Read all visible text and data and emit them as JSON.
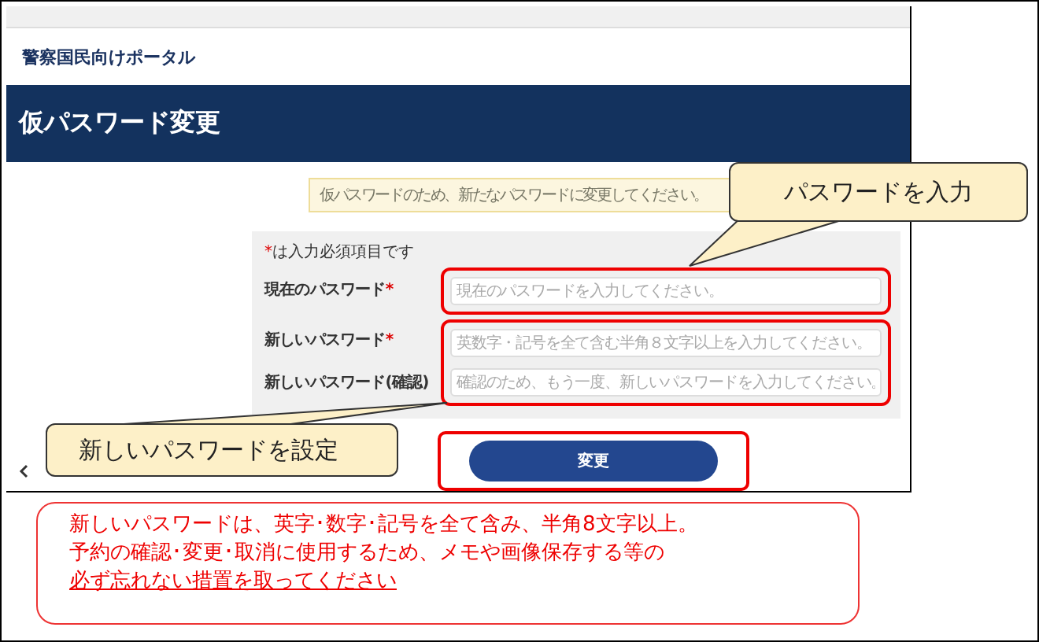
{
  "portal_name": "警察国民向けポータル",
  "banner_title": "仮パスワード変更",
  "notice": "仮パスワードのため、新たなパスワードに変更してください。",
  "form": {
    "required_note": {
      "mark": "*",
      "text": "は入力必須項目です"
    },
    "groups": [
      {
        "highlighted": true,
        "fields": [
          {
            "label": "現在のパスワード",
            "mark": "*",
            "placeholder": "現在のパスワードを入力してください。"
          }
        ]
      },
      {
        "highlighted": true,
        "fields": [
          {
            "label": "新しいパスワード",
            "mark": "*",
            "placeholder": "英数字・記号を全て含む半角８文字以上を入力してください。"
          },
          {
            "label": "新しいパスワード(確認)",
            "placeholder": "確認のため、もう一度、新しいパスワードを入力してください。"
          }
        ]
      }
    ]
  },
  "submit": {
    "label": "変更",
    "highlighted": true
  },
  "callouts": [
    {
      "text": "パスワードを入力"
    },
    {
      "text": "新しいパスワードを設定"
    }
  ],
  "note": {
    "lines": [
      "新しいパスワードは、英字･数字･記号を全て含み、半角8文字以上。",
      "予約の確認･変更･取消に使用するため、メモや画像保存する等の"
    ],
    "underlined_line": "必ず忘れない措置を取ってください"
  }
}
